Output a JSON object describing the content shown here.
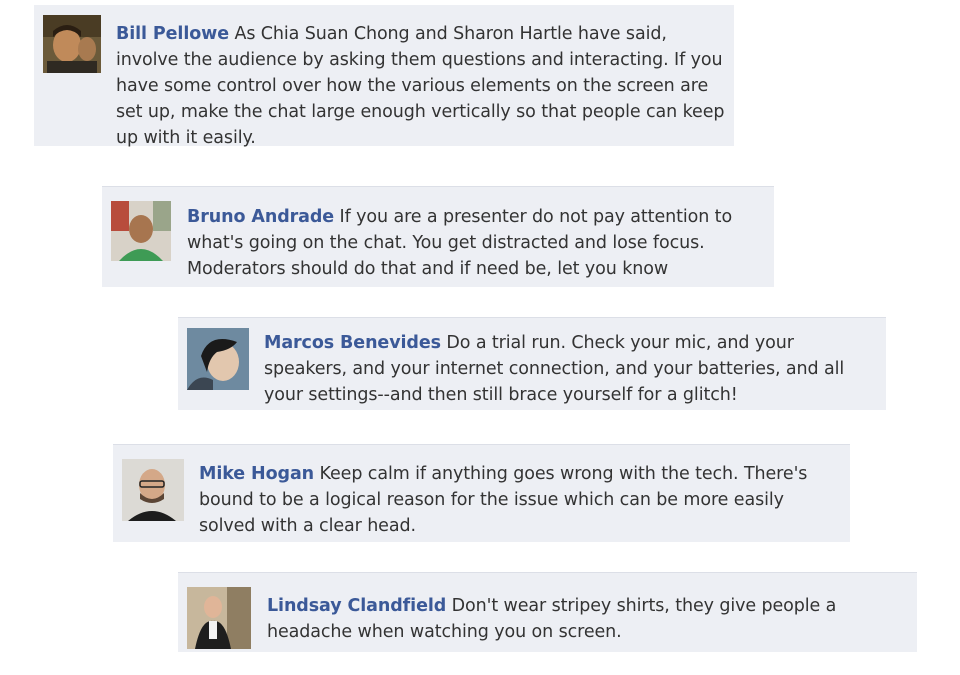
{
  "comments": [
    {
      "author": "Bill Pellowe",
      "text": "As Chia Suan Chong and Sharon Hartle have said, involve the audience by asking them questions and interacting. If you have some control over how the various elements on the screen are set up, make the chat large enough vertically so that people can keep up with it easily.",
      "avatar": "profile-photo-icon"
    },
    {
      "author": "Bruno Andrade",
      "text": "If you are a presenter do not pay attention to what's going on the chat. You get distracted and lose focus. Moderators should do that and if need be, let you know",
      "avatar": "profile-photo-icon"
    },
    {
      "author": "Marcos Benevides",
      "text": "Do a trial run. Check your mic, and your speakers, and your internet connection, and your batteries, and all your settings--and then still brace yourself for a glitch!",
      "avatar": "profile-photo-icon"
    },
    {
      "author": "Mike Hogan",
      "text": "Keep calm if anything goes wrong with the tech. There's bound to be a logical reason for the issue which can be more easily solved with a clear head.",
      "avatar": "profile-photo-icon"
    },
    {
      "author": "Lindsay Clandfield",
      "text": "Don't wear stripey shirts, they give people a headache when watching you on screen.",
      "avatar": "profile-photo-icon"
    }
  ],
  "colors": {
    "comment_background": "#edeff4",
    "author_link": "#3b5998",
    "body_text": "#333333"
  }
}
